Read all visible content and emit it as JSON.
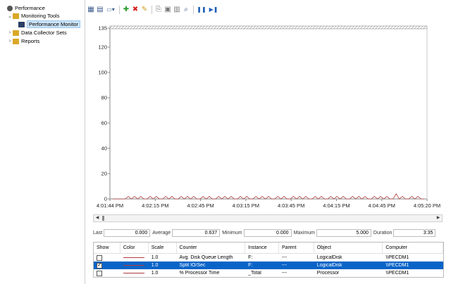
{
  "tree": [
    {
      "label": "Performance",
      "level": 0,
      "arrow": "",
      "icon": "performance-icon",
      "selected": false
    },
    {
      "label": "Monitoring Tools",
      "level": 1,
      "arrow": "⌄",
      "icon": "folder-icon",
      "selected": false
    },
    {
      "label": "Performance Monitor",
      "level": 2,
      "arrow": "",
      "icon": "monitor-icon",
      "selected": true
    },
    {
      "label": "Data Collector Sets",
      "level": 1,
      "arrow": "›",
      "icon": "folder-icon",
      "selected": false
    },
    {
      "label": "Reports",
      "level": 1,
      "arrow": "›",
      "icon": "folder-icon",
      "selected": false
    }
  ],
  "toolbar": [
    {
      "name": "view-current-activity-button",
      "glyph": "▦",
      "color": "#3a5a8c"
    },
    {
      "name": "view-log-data-button",
      "glyph": "▤",
      "color": "#3a5a8c"
    },
    {
      "name": "change-graph-type-button",
      "glyph": "▭▾",
      "color": "#3a5a8c"
    },
    {
      "name": "sep"
    },
    {
      "name": "add-counter-button",
      "glyph": "✚",
      "color": "#2e9a2e"
    },
    {
      "name": "delete-counter-button",
      "glyph": "✖",
      "color": "#d62020"
    },
    {
      "name": "highlight-button",
      "glyph": "✎",
      "color": "#c8a020"
    },
    {
      "name": "sep"
    },
    {
      "name": "copy-properties-button",
      "glyph": "⎘",
      "color": "#777"
    },
    {
      "name": "paste-counter-list-button",
      "glyph": "▣",
      "color": "#777"
    },
    {
      "name": "properties-button",
      "glyph": "▥",
      "color": "#777"
    },
    {
      "name": "zoom-button",
      "glyph": "⌕",
      "color": "#3a5a8c"
    },
    {
      "name": "sep"
    },
    {
      "name": "freeze-display-button",
      "glyph": "❚❚",
      "color": "#1e62b8"
    },
    {
      "name": "update-data-button",
      "glyph": "▶❚",
      "color": "#1e62b8"
    }
  ],
  "chart_data": {
    "type": "line",
    "ylim": [
      0,
      135
    ],
    "yticks": [
      0,
      20,
      40,
      60,
      80,
      100,
      120,
      135
    ],
    "xticks": [
      "4:01:44 PM",
      "4:02:15 PM",
      "4:02:45 PM",
      "4:03:15 PM",
      "4:03:45 PM",
      "4:04:15 PM",
      "4:04:45 PM",
      "4:05:20 PM"
    ],
    "series": [
      {
        "color": "#b13c3c",
        "values": [
          0,
          0,
          0,
          0,
          0,
          2,
          0,
          2,
          0,
          2,
          0,
          0,
          2,
          0,
          2,
          0,
          0,
          2,
          0,
          2,
          0,
          0,
          2,
          0,
          2,
          0,
          2,
          0,
          0,
          2,
          0,
          2,
          0,
          0,
          2,
          0,
          2,
          0,
          2,
          0,
          0,
          2,
          0,
          2,
          0,
          0,
          2,
          0,
          2,
          0,
          2,
          0,
          0,
          2,
          0,
          2,
          0,
          0,
          2,
          0,
          2,
          0,
          2,
          0,
          0,
          2,
          0,
          2,
          0,
          0,
          2,
          0,
          2,
          0,
          2,
          0,
          0,
          2,
          0,
          2,
          0,
          2,
          0,
          0,
          2,
          0,
          2,
          0,
          2,
          0,
          0,
          4,
          0,
          2,
          0,
          0,
          2,
          0,
          2,
          0,
          0
        ]
      }
    ]
  },
  "stats": {
    "last_label": "Last",
    "last": "0.000",
    "average_label": "Average",
    "average": "0.637",
    "minimum_label": "Minimum",
    "minimum": "0.000",
    "maximum_label": "Maximum",
    "maximum": "5.000",
    "duration_label": "Duration",
    "duration": "3:35"
  },
  "table": {
    "headers": [
      "Show",
      "Color",
      "Scale",
      "Counter",
      "Instance",
      "Parent",
      "Object",
      "Computer"
    ],
    "rows": [
      {
        "checked": false,
        "selected": false,
        "scale": "1.0",
        "counter": "Avg. Disk Queue Length",
        "instance": "F:",
        "parent": "---",
        "object": "LogicalDisk",
        "computer": "\\\\PECDM1"
      },
      {
        "checked": true,
        "selected": true,
        "scale": "1.0",
        "counter": "Split IO/Sec",
        "instance": "F:",
        "parent": "---",
        "object": "LogicalDisk",
        "computer": "\\\\PECDM1"
      },
      {
        "checked": false,
        "selected": false,
        "scale": "1.0",
        "counter": "% Processor Time",
        "instance": "_Total",
        "parent": "---",
        "object": "Processor",
        "computer": "\\\\PECDM1"
      }
    ]
  },
  "scrollbar": {
    "left_glyph": "◀",
    "right_glyph": "▶"
  }
}
